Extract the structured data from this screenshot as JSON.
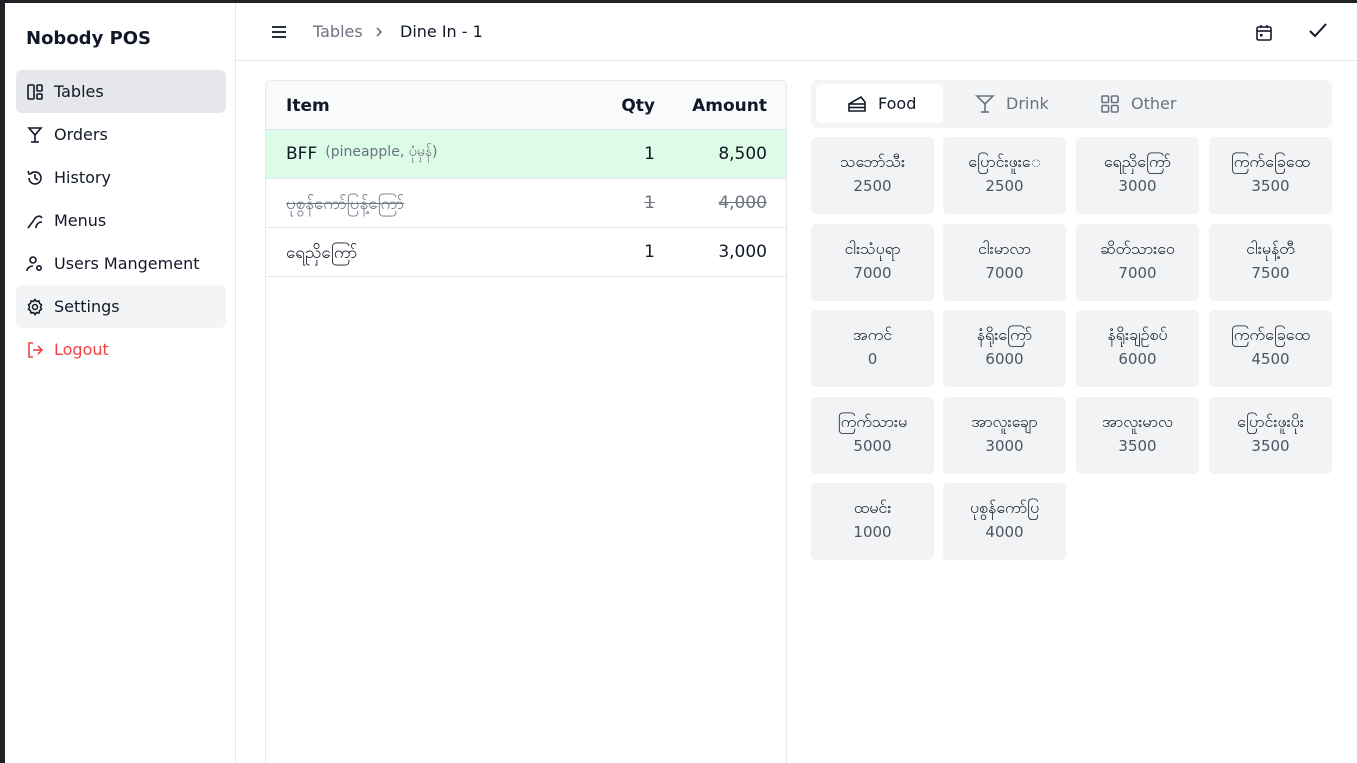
{
  "app": {
    "brand": "Nobody POS"
  },
  "sidebar": {
    "items": [
      {
        "label": "Tables",
        "icon": "layout-panel-icon",
        "active": true
      },
      {
        "label": "Orders",
        "icon": "cocktail-glass-icon"
      },
      {
        "label": "History",
        "icon": "history-icon"
      },
      {
        "label": "Menus",
        "icon": "menu-dish-icon"
      },
      {
        "label": "Users Mangement",
        "icon": "user-cog-icon"
      },
      {
        "label": "Settings",
        "icon": "gear-icon"
      },
      {
        "label": "Logout",
        "icon": "logout-icon"
      }
    ]
  },
  "header": {
    "breadcrumb_parent": "Tables",
    "breadcrumb_current": "Dine In - 1"
  },
  "order": {
    "columns": {
      "item": "Item",
      "qty": "Qty",
      "amount": "Amount"
    },
    "rows": [
      {
        "name": "BFF",
        "note": "(pineapple, ပုံမှန်)",
        "qty": "1",
        "amount": "8,500",
        "state": "selected"
      },
      {
        "name": "ပုစွန်ကော်ပြန့်ကြော်",
        "note": "",
        "qty": "1",
        "amount": "4,000",
        "state": "voided"
      },
      {
        "name": "ရေညှိကြော်",
        "note": "",
        "qty": "1",
        "amount": "3,000",
        "state": "normal"
      }
    ]
  },
  "categories": [
    {
      "label": "Food",
      "icon": "cake-slice-icon",
      "active": true
    },
    {
      "label": "Drink",
      "icon": "cocktail-glass-icon"
    },
    {
      "label": "Other",
      "icon": "grid-icon"
    }
  ],
  "menu_items": [
    {
      "name": "သဘော်သီး",
      "price": "2500"
    },
    {
      "name": "ပြောင်းဖူးေ",
      "price": "2500"
    },
    {
      "name": "ရေညှိကြော်",
      "price": "3000"
    },
    {
      "name": "ကြက်ခြေထေ",
      "price": "3500"
    },
    {
      "name": "ငါးသံပုရာ",
      "price": "7000"
    },
    {
      "name": "ငါးမာလာ",
      "price": "7000"
    },
    {
      "name": "ဆိတ်သားဝေ",
      "price": "7000"
    },
    {
      "name": "ငါးမုန့်တီ",
      "price": "7500"
    },
    {
      "name": "အကင်",
      "price": "0"
    },
    {
      "name": "နံရိုးကြော်",
      "price": "6000"
    },
    {
      "name": "နံရိုးချဉ်စပ်",
      "price": "6000"
    },
    {
      "name": "ကြက်ခြေထေ",
      "price": "4500"
    },
    {
      "name": "ကြက်သားမ",
      "price": "5000"
    },
    {
      "name": "အာလူးချော",
      "price": "3000"
    },
    {
      "name": "အာလူးမာလ",
      "price": "3500"
    },
    {
      "name": "ပြောင်းဖူးပိုး",
      "price": "3500"
    },
    {
      "name": "ထမင်း",
      "price": "1000"
    },
    {
      "name": "ပုစွန်ကော်ပြ",
      "price": "4000"
    }
  ]
}
